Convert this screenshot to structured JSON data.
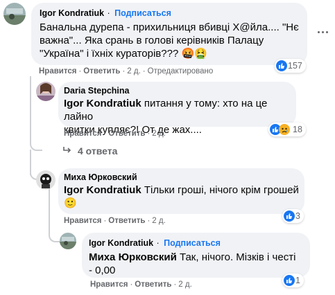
{
  "comments": [
    {
      "author": "Igor Kondratiuk",
      "follow": "Подписаться",
      "text_line1": "Банальна дурепа - прихильниця вбивці Х@йла.... \"Нє",
      "text_line2": "важна\"... Яка срань в голові керівників Палацу",
      "text_line3": "\"Україна\" і їхніх кураторів??? 🤬🤮",
      "like": "Нравится",
      "reply": "Ответить",
      "time": "2 д.",
      "edited": "Отредактировано",
      "reactions": "157"
    },
    {
      "author": "Daria Stepchina",
      "mention": "Igor Kondratiuk",
      "text_line1": " питання у тому: хто на це лайно",
      "text_line2": "квитки купляє?! От де жах....",
      "like": "Нравится",
      "reply": "Ответить",
      "time": "2 д.",
      "reactions": "18"
    },
    {
      "replies_link": "4 ответа"
    },
    {
      "author": "Миха Юрковский",
      "mention": "Igor Kondratiuk",
      "text_line1": " Тільки гроші, нічого крім грошей",
      "text_line2": "🙂",
      "like": "Нравится",
      "reply": "Ответить",
      "time": "2 д.",
      "reactions": "3"
    },
    {
      "author": "Igor Kondratiuk",
      "follow": "Подписаться",
      "mention": "Миха Юрковский",
      "text_line1": " Так, нічого. Мізків і честі",
      "text_line2": "- 0,00",
      "like": "Нравится",
      "reply": "Ответить",
      "time": "2 д.",
      "reactions": "1"
    }
  ],
  "separator": "·",
  "colors": {
    "link": "#1877f2",
    "bubble": "#f0f2f5",
    "meta": "#65676b"
  }
}
